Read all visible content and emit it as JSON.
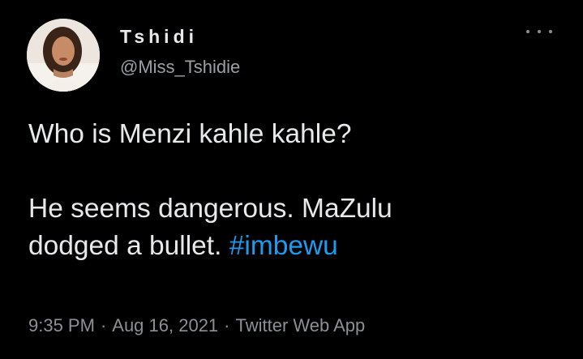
{
  "user": {
    "display_name": "Tshidi",
    "handle": "@Miss_Tshidie",
    "avatar": "profile-photo"
  },
  "more_menu": {
    "icon": "more-horizontal-icon"
  },
  "tweet": {
    "line1": "Who is Menzi kahle kahle?",
    "line2": "He seems dangerous. MaZulu",
    "line3": "dodged a bullet.",
    "hashtag": "#imbewu"
  },
  "meta": {
    "time": "9:35 PM",
    "separator": "·",
    "date": "Aug 16, 2021",
    "source": "Twitter Web App"
  },
  "colors": {
    "background": "#000000",
    "text": "#e7e9ea",
    "secondary": "#8b9096",
    "link": "#1d9bf0"
  }
}
